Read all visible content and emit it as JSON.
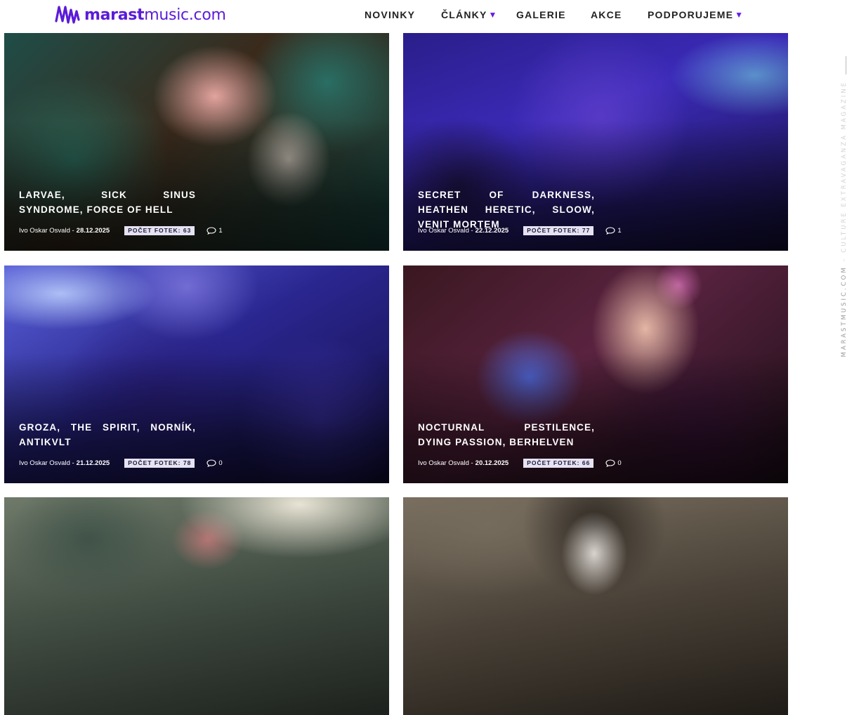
{
  "header": {
    "logo_bold": "marast",
    "logo_rest": "music.com",
    "nav": [
      {
        "label": "NOVINKY",
        "dropdown": false
      },
      {
        "label": "ČLÁNKY",
        "dropdown": true
      },
      {
        "label": "GALERIE",
        "dropdown": false
      },
      {
        "label": "AKCE",
        "dropdown": false
      },
      {
        "label": "PODPORUJEME",
        "dropdown": true
      }
    ],
    "accent_color": "#5b1bd8"
  },
  "gallery": [
    {
      "title": "Larvae, Sick Sinus Syndrome, Force of Hell",
      "author": "Ivo Oskar Osvald",
      "date": "28.12.2025",
      "photos_label": "POČET FOTEK: 63",
      "comments": "1"
    },
    {
      "title": "Secret of Darkness, Heathen Heretic, Sloow, Venit Mortem",
      "author": "Ivo Oskar Osvald",
      "date": "22.12.2025",
      "photos_label": "POČET FOTEK: 77",
      "comments": "1"
    },
    {
      "title": "Groza, The Spirit, Norník, Antikvlt",
      "author": "Ivo Oskar Osvald",
      "date": "21.12.2025",
      "photos_label": "POČET FOTEK: 78",
      "comments": "0"
    },
    {
      "title": "Nocturnal Pestilence, Dying Passion, Berhelven",
      "author": "Ivo Oskar Osvald",
      "date": "20.12.2025",
      "photos_label": "POČET FOTEK: 66",
      "comments": "0"
    }
  ],
  "sidebar": {
    "site": "MARASTMUSIC.COM",
    "separator": " – ",
    "tagline": "CULTURE EXTRAVAGANZA MAGAZINE"
  },
  "icons": {
    "comment": "speech-bubble-icon",
    "dropdown": "triangle-down-icon",
    "logo": "waveform-logo-icon"
  }
}
